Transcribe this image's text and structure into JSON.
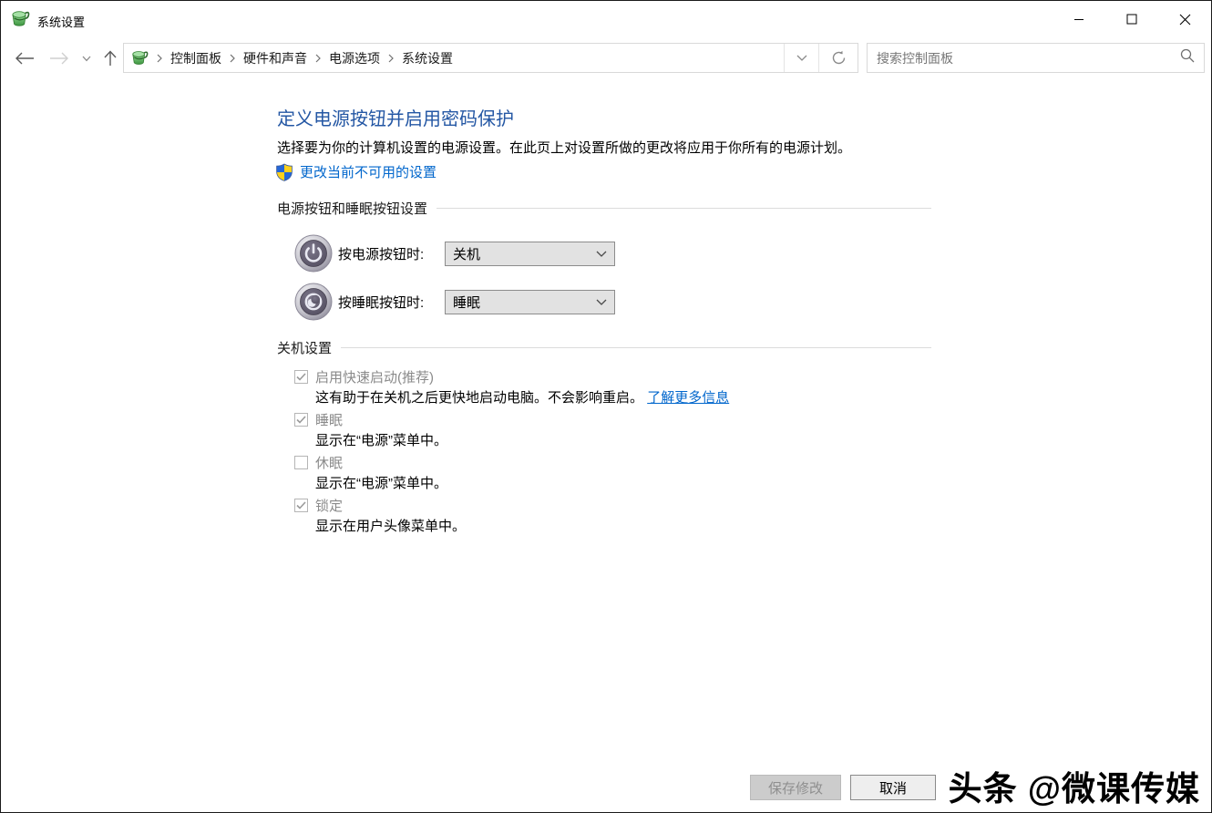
{
  "window": {
    "title": "系统设置"
  },
  "navbar": {
    "breadcrumb": {
      "items": [
        "控制面板",
        "硬件和声音",
        "电源选项",
        "系统设置"
      ]
    },
    "search": {
      "placeholder": "搜索控制面板"
    }
  },
  "main": {
    "heading": "定义电源按钮并启用密码保护",
    "description": "选择要为你的计算机设置的电源设置。在此页上对设置所做的更改将应用于你所有的电源计划。",
    "uac_link": "更改当前不可用的设置",
    "buttons_section": {
      "header": "电源按钮和睡眠按钮设置",
      "rows": [
        {
          "label": "按电源按钮时:",
          "value": "关机"
        },
        {
          "label": "按睡眠按钮时:",
          "value": "睡眠"
        }
      ]
    },
    "shutdown_section": {
      "header": "关机设置",
      "items": [
        {
          "label": "启用快速启动(推荐)",
          "checked": true,
          "disabled": true,
          "description": "这有助于在关机之后更快地启动电脑。不会影响重启。",
          "link": "了解更多信息"
        },
        {
          "label": "睡眠",
          "checked": true,
          "disabled": true,
          "description": "显示在“电源”菜单中。"
        },
        {
          "label": "休眠",
          "checked": false,
          "disabled": true,
          "description": "显示在“电源”菜单中。"
        },
        {
          "label": "锁定",
          "checked": true,
          "disabled": true,
          "description": "显示在用户头像菜单中。"
        }
      ]
    }
  },
  "footer": {
    "save_label": "保存修改",
    "cancel_label": "取消"
  },
  "watermark": "头条 @微课传媒",
  "colors": {
    "link_blue": "#0066cc",
    "heading_blue": "#2457a4"
  }
}
